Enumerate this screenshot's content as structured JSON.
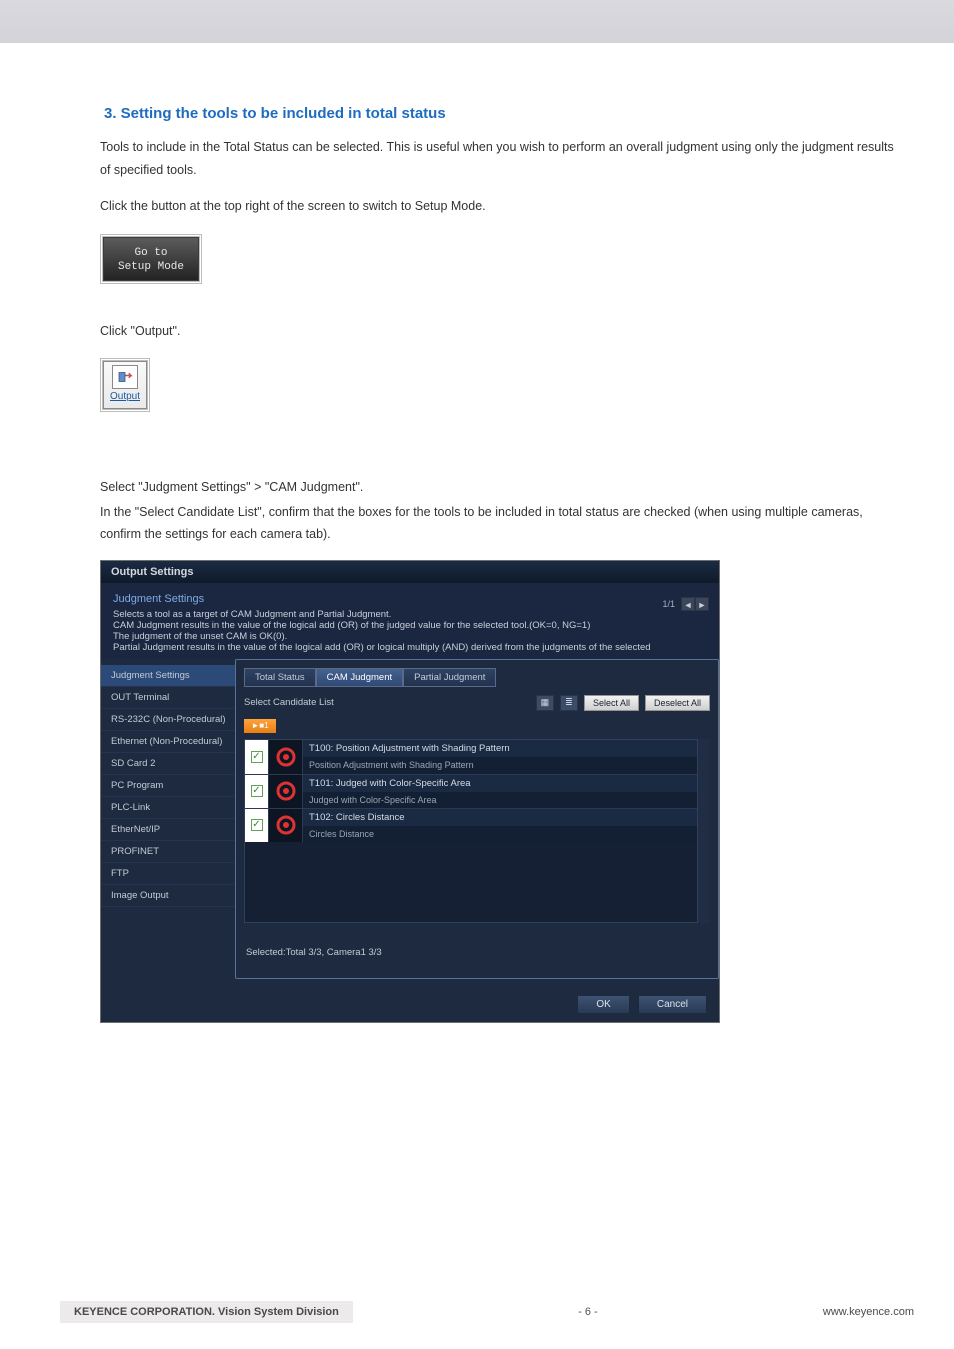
{
  "heading": "3. Setting the tools to be included in total status",
  "intro_p1": "Tools to include in the Total Status can be selected. This is useful when you wish to perform an overall judgment using only the judgment results of specified tools.",
  "step1": "Click the button at the top right of the screen to switch to Setup Mode.",
  "setup_button": {
    "line1": "Go to",
    "line2": "Setup Mode"
  },
  "step2": "Click \"Output\".",
  "output_button_caption": "Output",
  "step3a": "Select \"Judgment Settings\" > \"CAM Judgment\".",
  "step3b": "In the \"Select Candidate List\", confirm that the boxes for the tools to be included in total status are checked (when using multiple cameras, confirm the settings for each camera tab).",
  "os": {
    "title": "Output Settings",
    "header_title": "Judgment Settings",
    "header_lines": [
      "Selects a tool as a target of CAM Judgment and Partial Judgment.",
      "CAM Judgment results in the value of the logical add (OR) of the judged value for the selected tool.(OK=0, NG=1)",
      "The judgment of the unset CAM is OK(0).",
      "Partial Judgment results in the value of the logical add (OR) or logical multiply (AND) derived from the judgments of the selected"
    ],
    "pager": {
      "label": "1/1"
    },
    "sidebar": {
      "selected": "Judgment Settings",
      "items": [
        "OUT Terminal",
        "RS-232C (Non-Procedural)",
        "Ethernet (Non-Procedural)",
        "SD Card 2",
        "PC Program",
        "PLC-Link",
        "EtherNet/IP",
        "PROFINET",
        "FTP",
        "Image Output"
      ]
    },
    "tabs": {
      "t1": "Total Status",
      "t2": "CAM Judgment",
      "t3": "Partial Judgment"
    },
    "list": {
      "label": "Select Candidate List",
      "select_all": "Select All",
      "deselect_all": "Deselect All",
      "cam_tab": "1",
      "rows": [
        {
          "name": "T100: Position Adjustment with Shading Pattern",
          "sub": "Position Adjustment with Shading Pattern"
        },
        {
          "name": "T101: Judged with Color-Specific Area",
          "sub": "Judged with Color-Specific Area"
        },
        {
          "name": "T102: Circles Distance",
          "sub": "Circles Distance"
        }
      ],
      "summary": "Selected:Total 3/3, Camera1 3/3"
    },
    "ok": "OK",
    "cancel": "Cancel"
  },
  "footer": {
    "left": "KEYENCE CORPORATION. Vision System Division",
    "center": "- 6 -",
    "right": "www.keyence.com"
  }
}
